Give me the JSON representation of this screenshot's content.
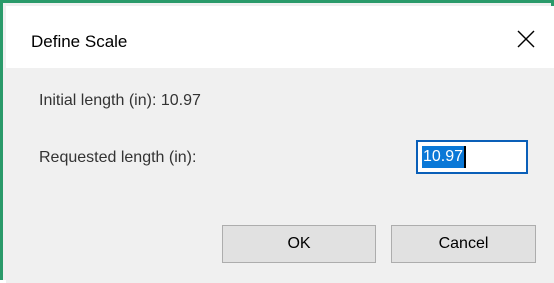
{
  "dialog": {
    "title": "Define Scale",
    "close_icon": "close-icon"
  },
  "form": {
    "initial_length_label": "Initial length (in): 10.97",
    "requested_length_label": "Requested length (in):",
    "requested_length_value": "10.97"
  },
  "buttons": {
    "ok_label": "OK",
    "cancel_label": "Cancel"
  },
  "colors": {
    "window_border": "#2a9a6a",
    "selection": "#0a78d7",
    "input_focus_border": "#0a5fb8"
  }
}
